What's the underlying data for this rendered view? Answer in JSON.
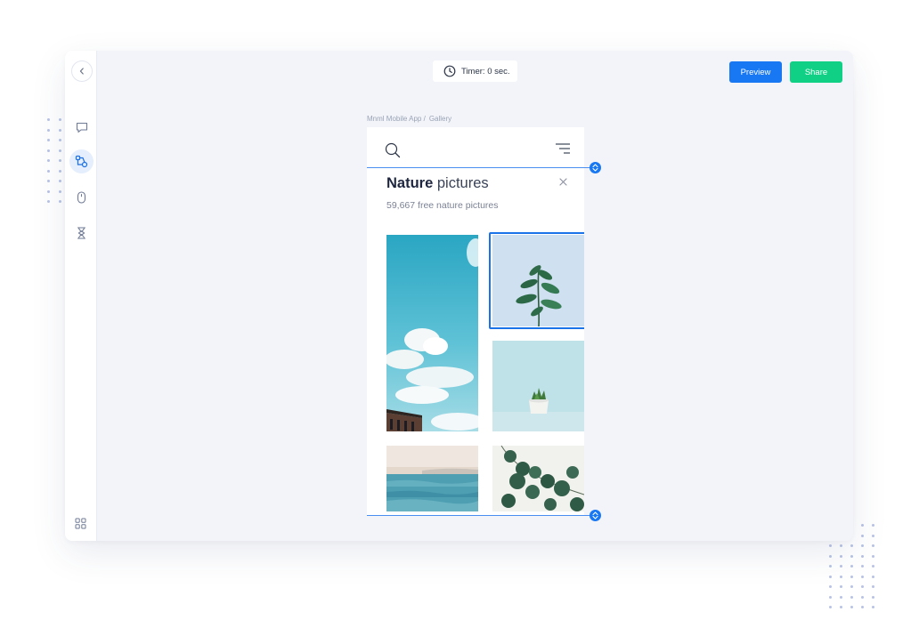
{
  "toolbar": {
    "timer_label": "Timer: 0 sec.",
    "preview_label": "Preview",
    "share_label": "Share",
    "accent_color": "#1877f2",
    "share_color": "#0fd084"
  },
  "sidebar": {
    "items": [
      {
        "icon": "back-icon"
      },
      {
        "icon": "comment-icon"
      },
      {
        "icon": "flow-icon",
        "active": true
      },
      {
        "icon": "mouse-icon"
      },
      {
        "icon": "hourglass-icon"
      },
      {
        "icon": "grid-icon"
      }
    ]
  },
  "breadcrumb": {
    "project": "Mnml Mobile App /",
    "page": "Gallery"
  },
  "screen": {
    "title_bold": "Nature",
    "title_rest": "pictures",
    "subtitle": "59,667 free nature pictures",
    "photos": [
      {
        "name": "sky-clouds-photo"
      },
      {
        "name": "plant-sprout-photo",
        "selected": true
      },
      {
        "name": "succulent-pot-photo"
      },
      {
        "name": "sea-shore-photo"
      },
      {
        "name": "eucalyptus-leaves-photo"
      }
    ]
  }
}
